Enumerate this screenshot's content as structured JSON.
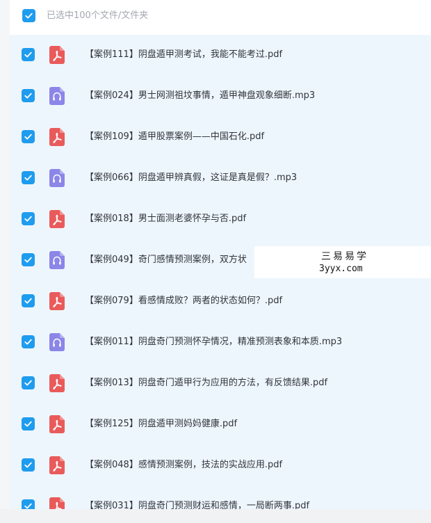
{
  "header": {
    "selection_text": "已选中100个文件/文件夹"
  },
  "colors": {
    "checkbox": "#1f9cee",
    "pdf_icon": "#e95b5b",
    "mp3_icon": "#8b86e8",
    "list_background": "#eef6fd"
  },
  "files": [
    {
      "name": "【案例111】阴盘遁甲测考试，我能不能考过.pdf",
      "type": "pdf",
      "icon": "pdf-icon",
      "checked": true
    },
    {
      "name": "【案例024】男士网测祖坟事情，遁甲神盘观象细断.mp3",
      "type": "mp3",
      "icon": "audio-file-icon",
      "checked": true
    },
    {
      "name": "【案例109】遁甲股票案例——中国石化.pdf",
      "type": "pdf",
      "icon": "pdf-icon",
      "checked": true
    },
    {
      "name": "【案例066】阴盘遁甲辨真假，这证是真是假？.mp3",
      "type": "mp3",
      "icon": "audio-file-icon",
      "checked": true
    },
    {
      "name": "【案例018】男士面测老婆怀孕与否.pdf",
      "type": "pdf",
      "icon": "pdf-icon",
      "checked": true
    },
    {
      "name": "【案例049】奇门感情预测案例，双方状",
      "type": "mp3",
      "icon": "audio-file-icon",
      "checked": true
    },
    {
      "name": "【案例079】看感情成败？两者的状态如何？.pdf",
      "type": "pdf",
      "icon": "pdf-icon",
      "checked": true
    },
    {
      "name": "【案例011】阴盘奇门预测怀孕情况，精准预测表象和本质.mp3",
      "type": "mp3",
      "icon": "audio-file-icon",
      "checked": true
    },
    {
      "name": "【案例013】阴盘奇门遁甲行为应用的方法，有反馈结果.pdf",
      "type": "pdf",
      "icon": "pdf-icon",
      "checked": true
    },
    {
      "name": "【案例125】阴盘遁甲测妈妈健康.pdf",
      "type": "pdf",
      "icon": "pdf-icon",
      "checked": true
    },
    {
      "name": "【案例048】感情预测案例，技法的实战应用.pdf",
      "type": "pdf",
      "icon": "pdf-icon",
      "checked": true
    },
    {
      "name": "【案例031】阴盘奇门预测财运和感情，一局断两事.pdf",
      "type": "pdf",
      "icon": "pdf-icon",
      "checked": true
    }
  ],
  "watermark": {
    "chinese": "三易易学",
    "site": "3yyx.com"
  }
}
